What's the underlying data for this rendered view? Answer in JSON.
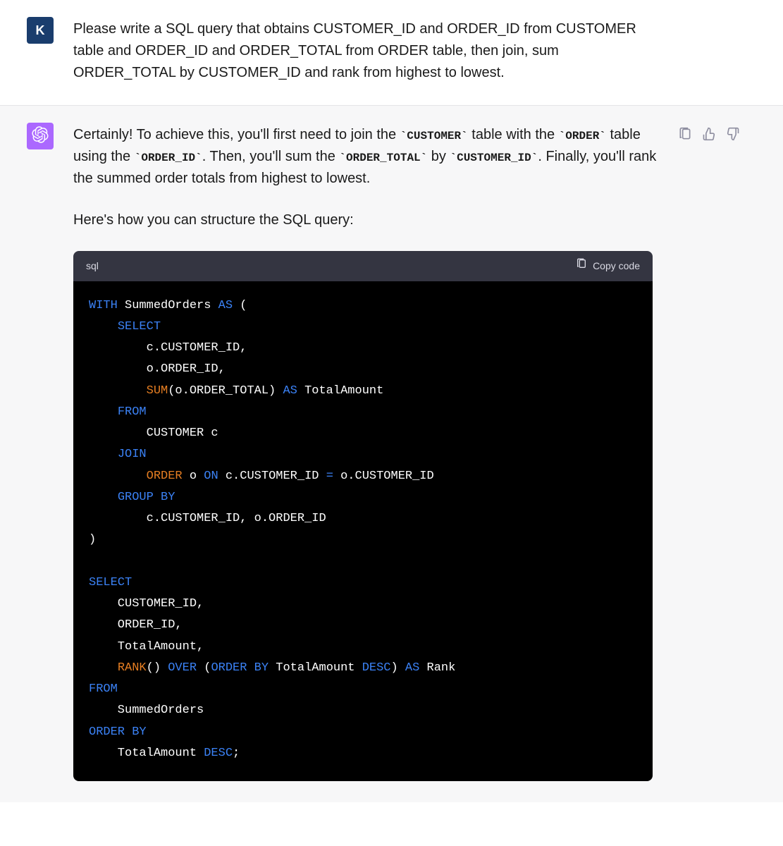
{
  "user": {
    "avatar_letter": "K",
    "message": "Please write a SQL query that obtains CUSTOMER_ID and ORDER_ID from CUSTOMER table and ORDER_ID and ORDER_TOTAL from ORDER table, then join, sum ORDER_TOTAL by CUSTOMER_ID and rank from highest to lowest."
  },
  "assistant": {
    "intro_parts": {
      "p1a": "Certainly! To achieve this, you'll first need to join the ",
      "c1": "`CUSTOMER`",
      "p1b": " table with the ",
      "c2": "`ORDER`",
      "p1c": " table using the ",
      "c3": "`ORDER_ID`",
      "p1d": ". Then, you'll sum the ",
      "c4": "`ORDER_TOTAL`",
      "p1e": " by ",
      "c5": "`CUSTOMER_ID`",
      "p1f": ". Finally, you'll rank the summed order totals from highest to lowest."
    },
    "intro2": "Here's how you can structure the SQL query:",
    "codeblock": {
      "language": "sql",
      "copy_label": "Copy code",
      "tokens": [
        {
          "t": "WITH",
          "c": "kw"
        },
        {
          "t": " SummedOrders ",
          "c": "txt"
        },
        {
          "t": "AS",
          "c": "kw"
        },
        {
          "t": " (\n",
          "c": "txt"
        },
        {
          "t": "    ",
          "c": "txt"
        },
        {
          "t": "SELECT",
          "c": "kw"
        },
        {
          "t": "\n",
          "c": "txt"
        },
        {
          "t": "        c.CUSTOMER_ID,\n",
          "c": "txt"
        },
        {
          "t": "        o.ORDER_ID,\n",
          "c": "txt"
        },
        {
          "t": "        ",
          "c": "txt"
        },
        {
          "t": "SUM",
          "c": "fn"
        },
        {
          "t": "(o.ORDER_TOTAL) ",
          "c": "txt"
        },
        {
          "t": "AS",
          "c": "kw"
        },
        {
          "t": " TotalAmount\n",
          "c": "txt"
        },
        {
          "t": "    ",
          "c": "txt"
        },
        {
          "t": "FROM",
          "c": "kw"
        },
        {
          "t": "\n",
          "c": "txt"
        },
        {
          "t": "        CUSTOMER c\n",
          "c": "txt"
        },
        {
          "t": "    ",
          "c": "txt"
        },
        {
          "t": "JOIN",
          "c": "kw"
        },
        {
          "t": "\n",
          "c": "txt"
        },
        {
          "t": "        ",
          "c": "txt"
        },
        {
          "t": "ORDER",
          "c": "fn"
        },
        {
          "t": " o ",
          "c": "txt"
        },
        {
          "t": "ON",
          "c": "kw"
        },
        {
          "t": " c.CUSTOMER_ID ",
          "c": "txt"
        },
        {
          "t": "=",
          "c": "kw"
        },
        {
          "t": " o.CUSTOMER_ID\n",
          "c": "txt"
        },
        {
          "t": "    ",
          "c": "txt"
        },
        {
          "t": "GROUP",
          "c": "kw"
        },
        {
          "t": " ",
          "c": "txt"
        },
        {
          "t": "BY",
          "c": "kw"
        },
        {
          "t": "\n",
          "c": "txt"
        },
        {
          "t": "        c.CUSTOMER_ID, o.ORDER_ID\n",
          "c": "txt"
        },
        {
          "t": ")\n",
          "c": "txt"
        },
        {
          "t": "\n",
          "c": "txt"
        },
        {
          "t": "SELECT",
          "c": "kw"
        },
        {
          "t": "\n",
          "c": "txt"
        },
        {
          "t": "    CUSTOMER_ID,\n",
          "c": "txt"
        },
        {
          "t": "    ORDER_ID,\n",
          "c": "txt"
        },
        {
          "t": "    TotalAmount,\n",
          "c": "txt"
        },
        {
          "t": "    ",
          "c": "txt"
        },
        {
          "t": "RANK",
          "c": "fn"
        },
        {
          "t": "() ",
          "c": "txt"
        },
        {
          "t": "OVER",
          "c": "kw"
        },
        {
          "t": " (",
          "c": "txt"
        },
        {
          "t": "ORDER",
          "c": "kw"
        },
        {
          "t": " ",
          "c": "txt"
        },
        {
          "t": "BY",
          "c": "kw"
        },
        {
          "t": " TotalAmount ",
          "c": "txt"
        },
        {
          "t": "DESC",
          "c": "kw"
        },
        {
          "t": ") ",
          "c": "txt"
        },
        {
          "t": "AS",
          "c": "kw"
        },
        {
          "t": " Rank\n",
          "c": "txt"
        },
        {
          "t": "FROM",
          "c": "kw"
        },
        {
          "t": "\n",
          "c": "txt"
        },
        {
          "t": "    SummedOrders\n",
          "c": "txt"
        },
        {
          "t": "ORDER",
          "c": "kw"
        },
        {
          "t": " ",
          "c": "txt"
        },
        {
          "t": "BY",
          "c": "kw"
        },
        {
          "t": "\n",
          "c": "txt"
        },
        {
          "t": "    TotalAmount ",
          "c": "txt"
        },
        {
          "t": "DESC",
          "c": "kw"
        },
        {
          "t": ";",
          "c": "txt"
        }
      ]
    }
  }
}
